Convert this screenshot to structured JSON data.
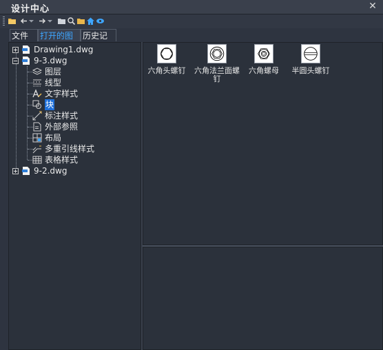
{
  "window": {
    "title": "设计中心"
  },
  "toolbar": {
    "icons": [
      "folder-load-icon",
      "back-icon",
      "dropdown-icon",
      "forward-icon",
      "dropdown-icon",
      "up-folder-icon",
      "search-icon",
      "favorites-icon",
      "home-icon",
      "tree-toggle-icon"
    ]
  },
  "tabs": [
    {
      "label": "文件夹",
      "active": false
    },
    {
      "label": "打开的图形",
      "active": true
    },
    {
      "label": "历史记录",
      "active": false
    }
  ],
  "tree": {
    "drawings": [
      {
        "label": "Drawing1.dwg",
        "expanded": false
      },
      {
        "label": "9-3.dwg",
        "expanded": true,
        "children": [
          {
            "label": "图层",
            "icon": "layers-icon"
          },
          {
            "label": "线型",
            "icon": "linetype-icon"
          },
          {
            "label": "文字样式",
            "icon": "text-style-icon"
          },
          {
            "label": "块",
            "icon": "block-icon",
            "selected": true
          },
          {
            "label": "标注样式",
            "icon": "dimension-style-icon"
          },
          {
            "label": "外部参照",
            "icon": "xref-icon"
          },
          {
            "label": "布局",
            "icon": "layout-icon"
          },
          {
            "label": "多重引线样式",
            "icon": "multileader-style-icon"
          },
          {
            "label": "表格样式",
            "icon": "table-style-icon"
          }
        ]
      },
      {
        "label": "9-2.dwg",
        "expanded": false
      }
    ]
  },
  "blocks": [
    {
      "label": "六角头螺钉",
      "icon": "hex-bolt-icon"
    },
    {
      "label": "六角法兰面螺钉",
      "icon": "hex-flange-bolt-icon"
    },
    {
      "label": "六角螺母",
      "icon": "hex-nut-icon"
    },
    {
      "label": "半圆头螺钉",
      "icon": "round-head-screw-icon"
    }
  ]
}
